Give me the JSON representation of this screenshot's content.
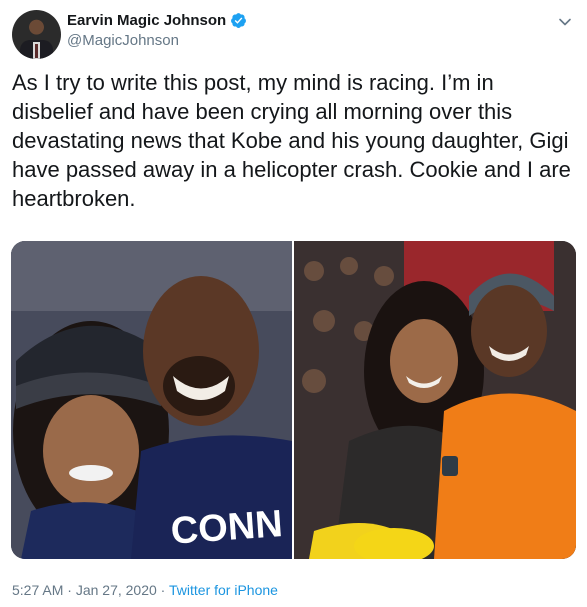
{
  "author": {
    "display_name": "Earvin Magic Johnson",
    "handle": "@MagicJohnson",
    "verified": true
  },
  "tweet": {
    "text": "As I try to write this post, my mind is racing. I’m in disbelief and have been crying all morning over this devastating news that Kobe and his young daughter, Gigi have passed away in a helicopter crash. Cookie and I are heartbroken."
  },
  "media": {
    "photos": [
      {
        "description_icon": "photo"
      },
      {
        "description_icon": "photo"
      }
    ],
    "left_shirt_text": "CONN"
  },
  "meta": {
    "time": "5:27 AM",
    "separator": " · ",
    "date": "Jan 27, 2020",
    "source": "Twitter for iPhone"
  },
  "colors": {
    "verified_blue": "#1da1f2",
    "link_blue": "#1b95e0",
    "muted": "#657786",
    "text": "#14171a"
  }
}
